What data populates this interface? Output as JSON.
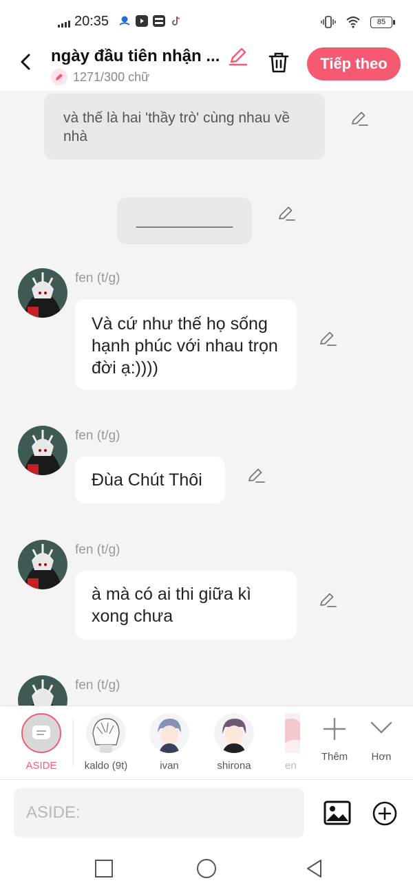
{
  "status_bar": {
    "time": "20:35",
    "battery": "85",
    "icons": [
      "signal-icon",
      "map-app-icon",
      "youtube-app-icon",
      "momo-app-icon",
      "tiktok-app-icon",
      "vibrate-icon",
      "wifi-icon",
      "battery-icon"
    ]
  },
  "header": {
    "title": "ngày đầu tiên nhận ...",
    "word_count": "1271/300 chữ",
    "next_label": "Tiếp theo",
    "accent_color": "#f55a72"
  },
  "chat": {
    "messages": [
      {
        "type": "aside",
        "text": "và thế là hai 'thầy trò' cùng nhau về nhà"
      },
      {
        "type": "aside",
        "text": "____________"
      },
      {
        "type": "message",
        "sender": "fen (t/g)",
        "text": "Và cứ như thế họ sống hạnh phúc với nhau trọn đời ạ:))))"
      },
      {
        "type": "message",
        "sender": "fen (t/g)",
        "text": "Đùa Chút Thôi"
      },
      {
        "type": "message",
        "sender": "fen (t/g)",
        "text": "à mà có ai thi giữa kì xong chưa"
      },
      {
        "type": "message",
        "sender": "fen (t/g)",
        "text": ""
      }
    ]
  },
  "characters": {
    "items": [
      {
        "label": "ASIDE",
        "selected": true
      },
      {
        "label": "kaldo (9t)"
      },
      {
        "label": "ivan"
      },
      {
        "label": "shirona"
      },
      {
        "label": "en"
      }
    ],
    "more_label": "Thêm",
    "expand_label": "Hơn"
  },
  "input": {
    "placeholder": "ASIDE:"
  }
}
